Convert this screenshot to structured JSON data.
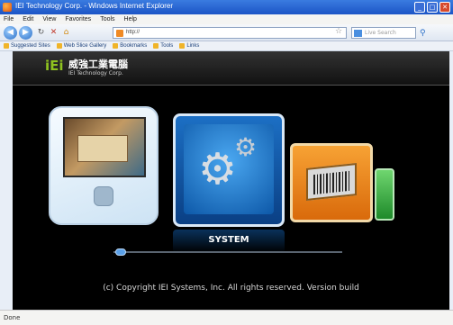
{
  "window": {
    "title": "IEI Technology Corp. - Windows Internet Explorer"
  },
  "menubar": {
    "items": [
      "File",
      "Edit",
      "View",
      "Favorites",
      "Tools",
      "Help"
    ]
  },
  "navbar": {
    "back_icon": "back-arrow-icon",
    "forward_icon": "forward-arrow-icon",
    "refresh_icon": "refresh-icon",
    "stop_icon": "stop-icon",
    "home_icon": "home-icon",
    "address": "http://",
    "search_placeholder": "Live Search"
  },
  "bookmarks": {
    "items": [
      "Suggested Sites",
      "Web Slice Gallery",
      "Bookmarks",
      "Tools",
      "Links"
    ]
  },
  "content": {
    "brand": {
      "logo": "iEi",
      "name": "威強工業電腦",
      "subtitle": "IEI Technology Corp."
    },
    "tiles": {
      "system_label": "SYSTEM"
    },
    "copyright": "(c) Copyright IEI Systems, Inc. All rights reserved. Version  build"
  },
  "status": {
    "text": "Done"
  },
  "colors": {
    "titlebar": "#1c55c6",
    "content_bg": "#000000",
    "brand_green": "#8fc31f",
    "system_blue": "#0d58a8",
    "barcode_orange": "#d96a0b",
    "green_tile": "#1e8a2a"
  }
}
